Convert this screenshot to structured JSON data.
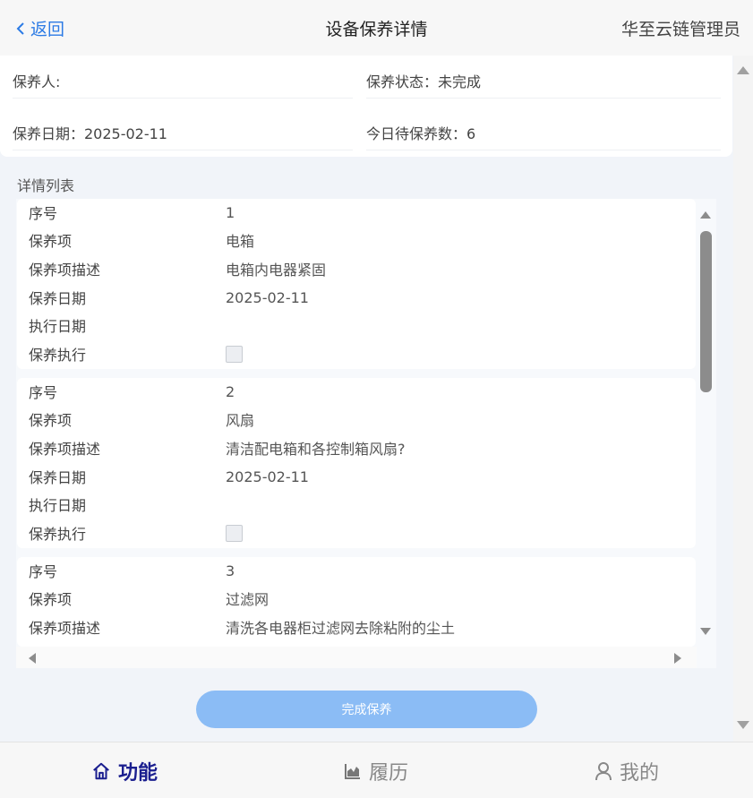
{
  "header": {
    "back_label": "返回",
    "title": "设备保养详情",
    "org": "华至云链管理员"
  },
  "summary": {
    "maintainer": "保养人:",
    "status": "保养状态：未完成",
    "date": "保养日期：2025-02-11",
    "pending": "今日待保养数：6"
  },
  "list_label": "详情列表",
  "field_labels": {
    "seq": "序号",
    "item": "保养项",
    "desc": "保养项描述",
    "date": "保养日期",
    "exec_date": "执行日期",
    "exec": "保养执行"
  },
  "items": [
    {
      "seq": "1",
      "item": "电箱",
      "desc": "电箱内电器紧固",
      "date": "2025-02-11",
      "exec_date": "",
      "checked": false
    },
    {
      "seq": "2",
      "item": "风扇",
      "desc": "清洁配电箱和各控制箱风扇?",
      "date": "2025-02-11",
      "exec_date": "",
      "checked": false
    },
    {
      "seq": "3",
      "item": "过滤网",
      "desc": "清洗各电器柜过滤网去除粘附的尘土"
    }
  ],
  "complete_button": "完成保养",
  "tabs": [
    {
      "label": "功能",
      "icon": "home-icon",
      "active": true
    },
    {
      "label": "履历",
      "icon": "chart-icon",
      "active": false
    },
    {
      "label": "我的",
      "icon": "user-icon",
      "active": false
    }
  ],
  "colors": {
    "accent": "#2c7be5",
    "button": "#8bbcf5",
    "active_tab": "#1b1f8f"
  }
}
